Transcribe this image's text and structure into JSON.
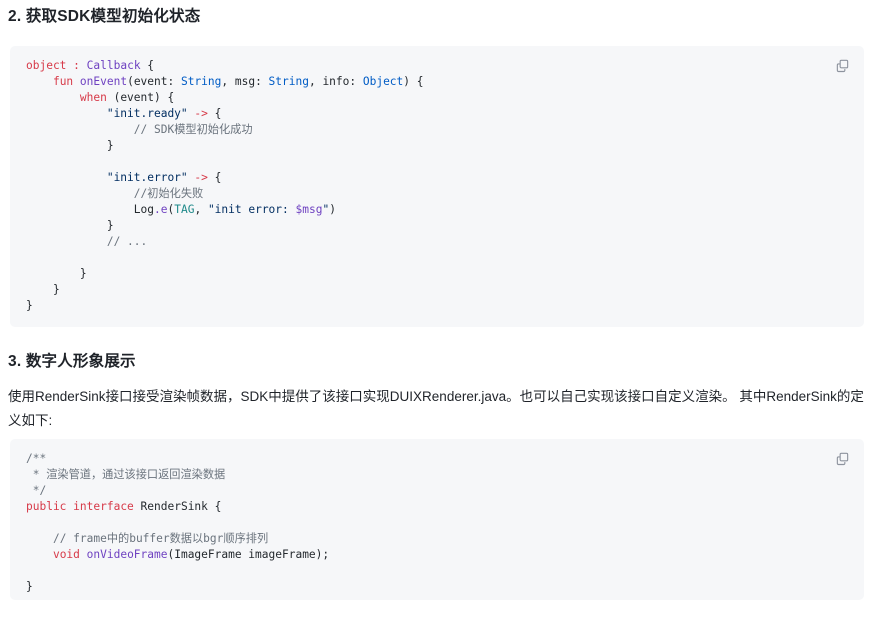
{
  "sections": [
    {
      "heading": "2. 获取SDK模型初始化状态",
      "code_lines": [
        [
          {
            "t": "object",
            "c": "kw"
          },
          {
            "t": " ",
            "c": "pln"
          },
          {
            "t": ":",
            "c": "kw"
          },
          {
            "t": " ",
            "c": "pln"
          },
          {
            "t": "Callback",
            "c": "type"
          },
          {
            "t": " {",
            "c": "punc"
          }
        ],
        [
          {
            "t": "    ",
            "c": "pln"
          },
          {
            "t": "fun",
            "c": "kw"
          },
          {
            "t": " ",
            "c": "pln"
          },
          {
            "t": "onEvent",
            "c": "fn"
          },
          {
            "t": "(event: ",
            "c": "pln"
          },
          {
            "t": "String",
            "c": "cls"
          },
          {
            "t": ", msg: ",
            "c": "pln"
          },
          {
            "t": "String",
            "c": "cls"
          },
          {
            "t": ", info: ",
            "c": "pln"
          },
          {
            "t": "Object",
            "c": "cls"
          },
          {
            "t": ") {",
            "c": "punc"
          }
        ],
        [
          {
            "t": "        ",
            "c": "pln"
          },
          {
            "t": "when",
            "c": "kw"
          },
          {
            "t": " (event) {",
            "c": "pln"
          }
        ],
        [
          {
            "t": "            ",
            "c": "pln"
          },
          {
            "t": "\"init.ready\"",
            "c": "str"
          },
          {
            "t": " ",
            "c": "pln"
          },
          {
            "t": "->",
            "c": "kw"
          },
          {
            "t": " {",
            "c": "punc"
          }
        ],
        [
          {
            "t": "                ",
            "c": "pln"
          },
          {
            "t": "// SDK模型初始化成功",
            "c": "cmt"
          }
        ],
        [
          {
            "t": "            }",
            "c": "punc"
          }
        ],
        [
          {
            "t": "",
            "c": "pln"
          }
        ],
        [
          {
            "t": "            ",
            "c": "pln"
          },
          {
            "t": "\"init.error\"",
            "c": "str"
          },
          {
            "t": " ",
            "c": "pln"
          },
          {
            "t": "->",
            "c": "kw"
          },
          {
            "t": " {",
            "c": "punc"
          }
        ],
        [
          {
            "t": "                ",
            "c": "pln"
          },
          {
            "t": "//初始化失败",
            "c": "cmt"
          }
        ],
        [
          {
            "t": "                ",
            "c": "pln"
          },
          {
            "t": "Log",
            "c": "pln"
          },
          {
            "t": ".e",
            "c": "fn"
          },
          {
            "t": "(",
            "c": "punc"
          },
          {
            "t": "TAG",
            "c": "var"
          },
          {
            "t": ", ",
            "c": "punc"
          },
          {
            "t": "\"init error: ",
            "c": "str"
          },
          {
            "t": "$msg",
            "c": "tpl"
          },
          {
            "t": "\"",
            "c": "str"
          },
          {
            "t": ")",
            "c": "punc"
          }
        ],
        [
          {
            "t": "            }",
            "c": "punc"
          }
        ],
        [
          {
            "t": "            ",
            "c": "pln"
          },
          {
            "t": "// ...",
            "c": "cmt"
          }
        ],
        [
          {
            "t": "",
            "c": "pln"
          }
        ],
        [
          {
            "t": "        }",
            "c": "punc"
          }
        ],
        [
          {
            "t": "    }",
            "c": "punc"
          }
        ],
        [
          {
            "t": "}",
            "c": "punc"
          }
        ]
      ],
      "copy_label": "copy-icon"
    },
    {
      "heading": "3. 数字人形象展示",
      "paragraph": "使用RenderSink接口接受渲染帧数据，SDK中提供了该接口实现DUIXRenderer.java。也可以自己实现该接口自定义渲染。 其中RenderSink的定义如下:",
      "code_lines": [
        [
          {
            "t": "/**",
            "c": "cmt"
          }
        ],
        [
          {
            "t": " * 渲染管道，通过该接口返回渲染数据",
            "c": "cmt"
          }
        ],
        [
          {
            "t": " */",
            "c": "cmt"
          }
        ],
        [
          {
            "t": "public",
            "c": "kw"
          },
          {
            "t": " ",
            "c": "pln"
          },
          {
            "t": "interface",
            "c": "kw"
          },
          {
            "t": " ",
            "c": "pln"
          },
          {
            "t": "RenderSink",
            "c": "pln"
          },
          {
            "t": " {",
            "c": "punc"
          }
        ],
        [
          {
            "t": "",
            "c": "pln"
          }
        ],
        [
          {
            "t": "    ",
            "c": "pln"
          },
          {
            "t": "// frame中的buffer数据以bgr顺序排列",
            "c": "cmt"
          }
        ],
        [
          {
            "t": "    ",
            "c": "pln"
          },
          {
            "t": "void",
            "c": "kw"
          },
          {
            "t": " ",
            "c": "pln"
          },
          {
            "t": "onVideoFrame",
            "c": "fn"
          },
          {
            "t": "(ImageFrame imageFrame);",
            "c": "pln"
          }
        ],
        [
          {
            "t": "",
            "c": "pln"
          }
        ],
        [
          {
            "t": "}",
            "c": "punc"
          }
        ]
      ],
      "copy_label": "copy-icon"
    }
  ],
  "colors": {
    "code_background": "#f6f7f9",
    "text": "#1f2329",
    "keyword": "#d73a49",
    "type": "#6f42c1",
    "builtin_type": "#005cc5",
    "string": "#032f62",
    "comment": "#6a737d",
    "variable": "#1f8a8a"
  }
}
